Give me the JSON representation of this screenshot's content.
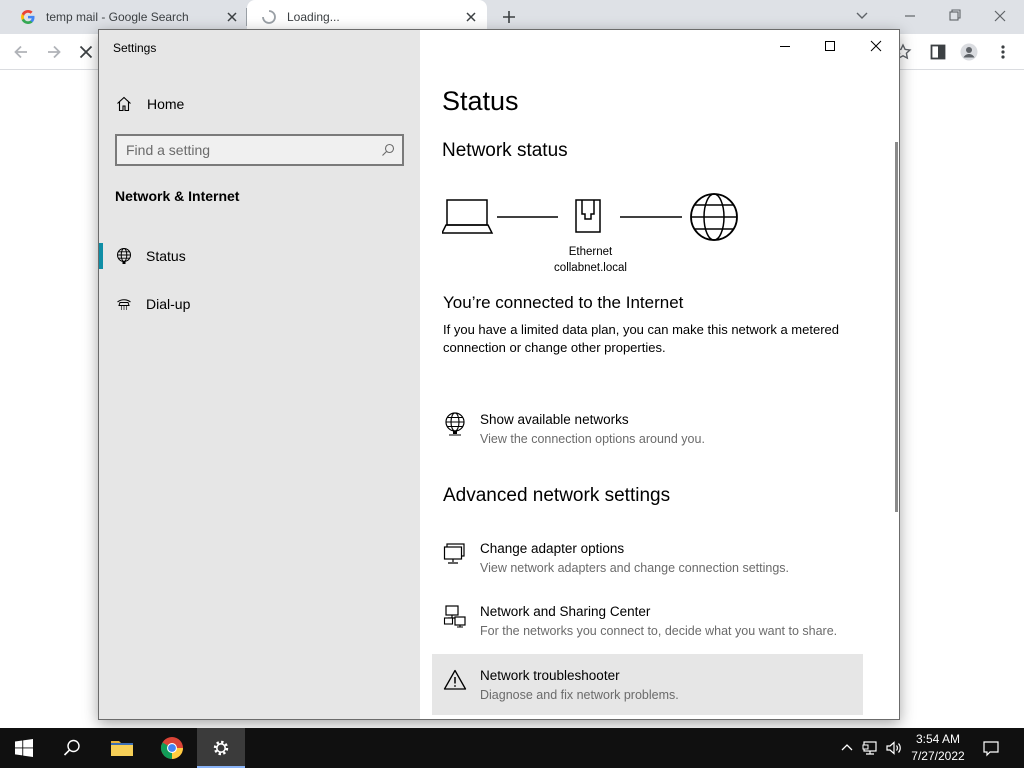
{
  "browser": {
    "tabs": [
      {
        "title": "temp mail - Google Search",
        "icon": "google-icon"
      },
      {
        "title": "Loading...",
        "icon": "loading-spinner-icon"
      }
    ]
  },
  "settings": {
    "app_title": "Settings",
    "sidebar": {
      "home_label": "Home",
      "search_placeholder": "Find a setting",
      "category": "Network & Internet",
      "items": [
        {
          "label": "Status",
          "icon": "globe-status-icon",
          "selected": true
        },
        {
          "label": "Dial-up",
          "icon": "dialup-icon",
          "selected": false
        }
      ]
    },
    "content": {
      "page_title": "Status",
      "network_status_heading": "Network status",
      "diagram": {
        "adapter_name": "Ethernet",
        "network_name": "collabnet.local"
      },
      "connected_title": "You’re connected to the Internet",
      "connected_desc": "If you have a limited data plan, you can make this network a metered connection or change other properties.",
      "show_networks": {
        "title": "Show available networks",
        "subtitle": "View the connection options around you."
      },
      "advanced_heading": "Advanced network settings",
      "advanced_items": [
        {
          "title": "Change adapter options",
          "subtitle": "View network adapters and change connection settings.",
          "icon": "adapter-icon"
        },
        {
          "title": "Network and Sharing Center",
          "subtitle": "For the networks you connect to, decide what you want to share.",
          "icon": "sharing-center-icon"
        },
        {
          "title": "Network troubleshooter",
          "subtitle": "Diagnose and fix network problems.",
          "icon": "warning-icon"
        }
      ]
    }
  },
  "taskbar": {
    "time": "3:54 AM",
    "date": "7/27/2022"
  },
  "colors": {
    "accent": "#0f8ea6",
    "sidebar_bg": "#e6e6e6",
    "taskbar_bg": "#101010"
  }
}
